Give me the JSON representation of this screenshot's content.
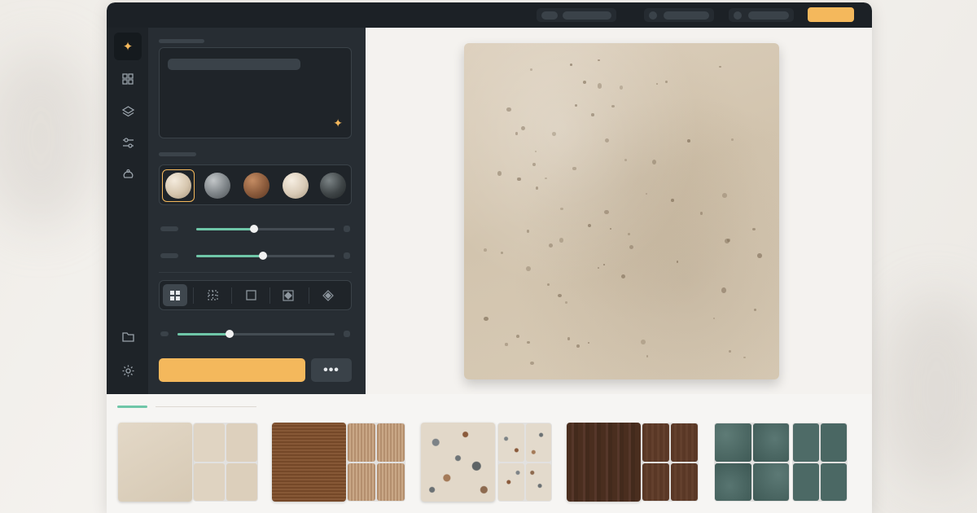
{
  "window": {
    "topbar": {
      "cta_label": ""
    }
  },
  "rail": {
    "items": [
      {
        "icon": "sparkle-icon",
        "active": true
      },
      {
        "icon": "grid-icon",
        "active": false
      },
      {
        "icon": "layers-icon",
        "active": false
      },
      {
        "icon": "sliders-icon",
        "active": false
      },
      {
        "icon": "bucket-icon",
        "active": false
      },
      {
        "icon": "folder-icon",
        "active": false
      },
      {
        "icon": "gear-icon",
        "active": false
      }
    ]
  },
  "panel": {
    "prompt": {
      "value": "",
      "placeholder": ""
    },
    "base_materials": [
      {
        "name": "travertine",
        "color": "#d6c6ae",
        "selected": true
      },
      {
        "name": "granite",
        "color": "#7d8387",
        "selected": false
      },
      {
        "name": "terracotta",
        "color": "#8a5a3b",
        "selected": false
      },
      {
        "name": "terrazzo",
        "color": "#d9cbb7",
        "selected": false
      },
      {
        "name": "slate",
        "color": "#3f4547",
        "selected": false
      }
    ],
    "sliders": [
      {
        "value": 0.42
      },
      {
        "value": 0.48
      },
      {
        "value": 0.33
      }
    ],
    "tile_modes": [
      {
        "icon": "tile-2x2-icon",
        "active": true
      },
      {
        "icon": "tile-dashed-icon",
        "active": false
      },
      {
        "icon": "tile-single-icon",
        "active": false
      },
      {
        "icon": "tile-offset-icon",
        "active": false
      },
      {
        "icon": "tile-diamond-icon",
        "active": false
      }
    ],
    "generate_label": "",
    "more_label": "•••"
  },
  "library": {
    "materials": [
      {
        "name": "travertine",
        "base": "#ddd1bf",
        "tile": "#ddd1bf"
      },
      {
        "name": "burlap",
        "base": "#b08c6c",
        "tile": "#bf9c7b"
      },
      {
        "name": "terrazzo",
        "base": "#ddd3c4",
        "tile": "#e0d7c9"
      },
      {
        "name": "walnut",
        "base": "#4a2e1f",
        "tile": "#5a3826"
      },
      {
        "name": "green-marble",
        "base": "#4c6965",
        "tile": "#4e6b67"
      }
    ]
  },
  "colors": {
    "accent": "#f4b85c",
    "slider": "#6fc6a8",
    "dark_panel": "#272d33"
  }
}
